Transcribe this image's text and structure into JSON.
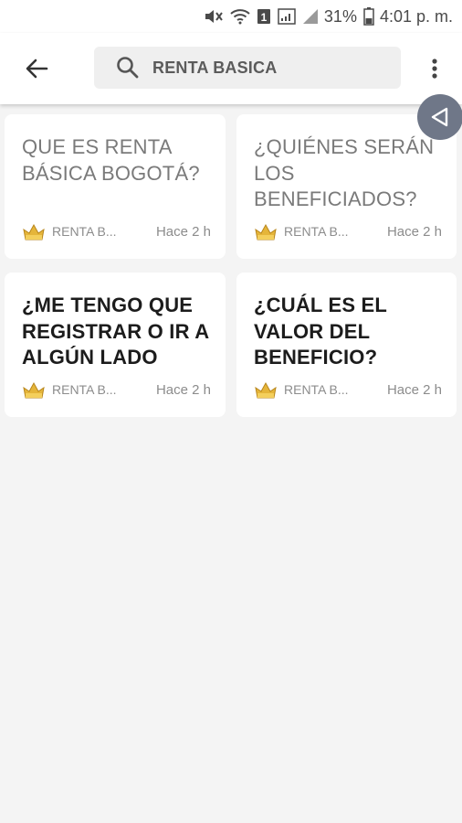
{
  "status_bar": {
    "battery": "31%",
    "time": "4:01 p. m.",
    "sim_label": "1"
  },
  "app_bar": {
    "search_value": "RENTA BASICA"
  },
  "cards": [
    {
      "title": "QUE ES  RENTA BÁSICA BOGOTÁ?",
      "source": "RENTA B...",
      "time": "Hace 2 h",
      "read": true
    },
    {
      "title": "¿QUIÉNES SERÁN LOS BENEFICIADOS?",
      "source": "RENTA B...",
      "time": "Hace 2 h",
      "read": true
    },
    {
      "title": "¿ME TENGO QUE REGISTRAR O IR A ALGÚN LADO",
      "source": "RENTA B...",
      "time": "Hace 2 h",
      "read": false
    },
    {
      "title": "¿CUÁL ES EL VALOR DEL BENEFICIO?",
      "source": "RENTA B...",
      "time": "Hace 2 h",
      "read": false
    }
  ],
  "colors": {
    "fab": "#6f7788",
    "read_title": "#7a7a7a",
    "unread_title": "#1c1c1c",
    "source_icon": "#e5b53a"
  }
}
